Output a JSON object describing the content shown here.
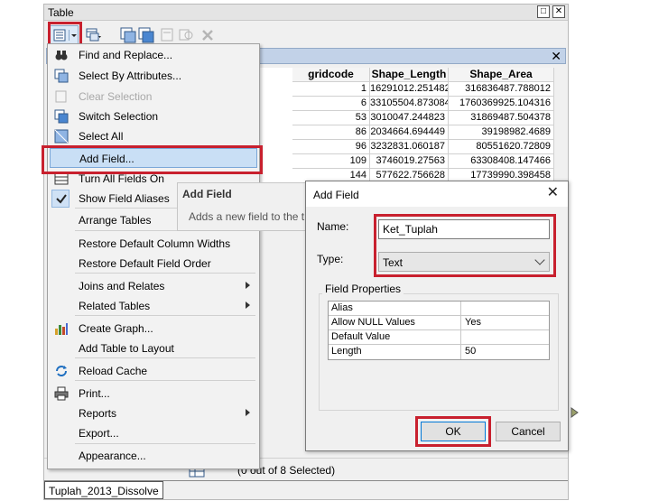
{
  "window": {
    "title": "Table",
    "min_label": "□",
    "close_label": "✕"
  },
  "tab_strip": {
    "close_label": "✕"
  },
  "grid": {
    "columns": [
      "gridcode",
      "Shape_Length",
      "Shape_Area"
    ],
    "rows": [
      [
        "1",
        "16291012.251482",
        "316836487.788012"
      ],
      [
        "6",
        "33105504.873084",
        "1760369925.104316"
      ],
      [
        "53",
        "3010047.244823",
        "31869487.504378"
      ],
      [
        "86",
        "2034664.694449",
        "39198982.4689"
      ],
      [
        "96",
        "3232831.060187",
        "80551620.72809"
      ],
      [
        "109",
        "3746019.27563",
        "63308408.147466"
      ],
      [
        "144",
        "577622.756628",
        "17739990.398458"
      ]
    ]
  },
  "menu": {
    "items": [
      {
        "label": "Find and Replace...",
        "icon": "binoculars-icon"
      },
      {
        "label": "Select By Attributes...",
        "icon": "select-attributes-icon"
      },
      {
        "label": "Clear Selection",
        "icon": "clear-selection-icon",
        "disabled": true
      },
      {
        "label": "Switch Selection",
        "icon": "switch-selection-icon"
      },
      {
        "label": "Select All",
        "icon": "select-all-icon"
      },
      {
        "label": "Add Field...",
        "icon": "",
        "highlighted": true
      },
      {
        "label": "Turn All Fields On",
        "icon": "fields-icon"
      },
      {
        "label": "Show Field Aliases",
        "icon": "checkmark-icon",
        "checked": true
      },
      {
        "label": "Arrange Tables",
        "icon": ""
      },
      {
        "label": "Restore Default Column Widths",
        "icon": ""
      },
      {
        "label": "Restore Default Field Order",
        "icon": ""
      },
      {
        "label": "Joins and Relates",
        "icon": "",
        "submenu": true
      },
      {
        "label": "Related Tables",
        "icon": "",
        "submenu": true
      },
      {
        "label": "Create Graph...",
        "icon": "bar-chart-icon"
      },
      {
        "label": "Add Table to Layout",
        "icon": ""
      },
      {
        "label": "Reload Cache",
        "icon": "reload-icon"
      },
      {
        "label": "Print...",
        "icon": "printer-icon"
      },
      {
        "label": "Reports",
        "icon": "",
        "submenu": true
      },
      {
        "label": "Export...",
        "icon": ""
      },
      {
        "label": "Appearance...",
        "icon": ""
      }
    ]
  },
  "tooltip": {
    "title": "Add Field",
    "body": "Adds a new field to the t"
  },
  "dialog": {
    "title": "Add Field",
    "close_label": "✕",
    "name_label": "Name:",
    "name_value": "Ket_Tuplah",
    "type_label": "Type:",
    "type_value": "Text",
    "field_properties_label": "Field Properties",
    "properties": [
      {
        "key": "Alias",
        "value": ""
      },
      {
        "key": "Allow NULL Values",
        "value": "Yes"
      },
      {
        "key": "Default Value",
        "value": ""
      },
      {
        "key": "Length",
        "value": "50"
      }
    ],
    "ok_label": "OK",
    "cancel_label": "Cancel"
  },
  "status": {
    "text": "(0 out of 8 Selected)"
  },
  "bottom_tab": {
    "label": "Tuplah_2013_Dissolve"
  },
  "colors": {
    "highlight_red": "#c8202e",
    "menu_highlight": "#c9dff5",
    "tab_strip": "#c2d2e8"
  }
}
